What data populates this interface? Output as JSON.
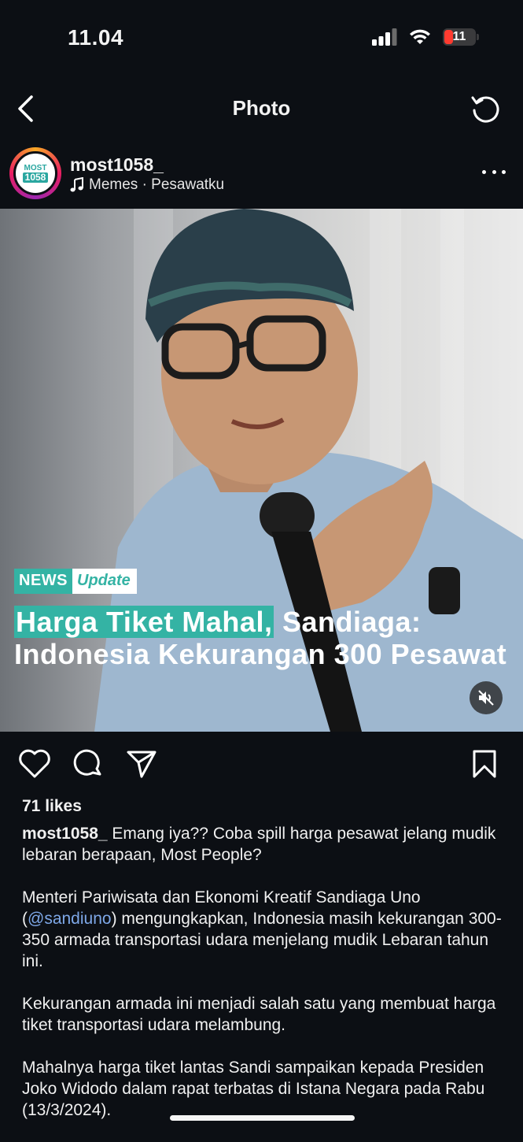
{
  "status_bar": {
    "time": "11.04",
    "battery_level": "11"
  },
  "nav": {
    "title": "Photo"
  },
  "post": {
    "avatar": {
      "top": "MOST",
      "bottom": "1058"
    },
    "username": "most1058_",
    "audio": "Memes · Pesawatku",
    "image": {
      "badge_news": "NEWS",
      "badge_update": "Update",
      "headline_highlight": "Harga Tiket Mahal,",
      "headline_rest": " Sandiaga: Indonesia Kekurangan 300 Pesawat"
    },
    "likes": "71 likes",
    "caption": {
      "username": "most1058_",
      "intro": " Emang iya?? Coba spill harga pesawat jelang mudik lebaran berapaan, Most People?",
      "p2_before": "Menteri Pariwisata dan Ekonomi Kreatif Sandiaga Uno (",
      "p2_mention": "@sandiuno",
      "p2_after": ") mengungkapkan, Indonesia masih kekurangan 300-350 armada transportasi udara menjelang mudik Lebaran tahun ini.",
      "p3": "Kekurangan armada ini menjadi salah satu yang membuat harga tiket transportasi udara melambung.",
      "p4": "Mahalnya harga tiket lantas Sandi sampaikan kepada Presiden Joko Widodo dalam rapat terbatas di Istana Negara pada Rabu (13/3/2024)."
    }
  },
  "colors": {
    "background": "#0c0f14",
    "accent_teal": "#34b3a4",
    "mention": "#7ea8e8",
    "battery_low": "#ff3b30"
  },
  "icons": [
    "signal-icon",
    "wifi-icon",
    "battery-icon",
    "back-chevron-icon",
    "refresh-icon",
    "music-note-icon",
    "more-icon",
    "mute-icon",
    "heart-icon",
    "comment-icon",
    "share-icon",
    "bookmark-icon"
  ]
}
